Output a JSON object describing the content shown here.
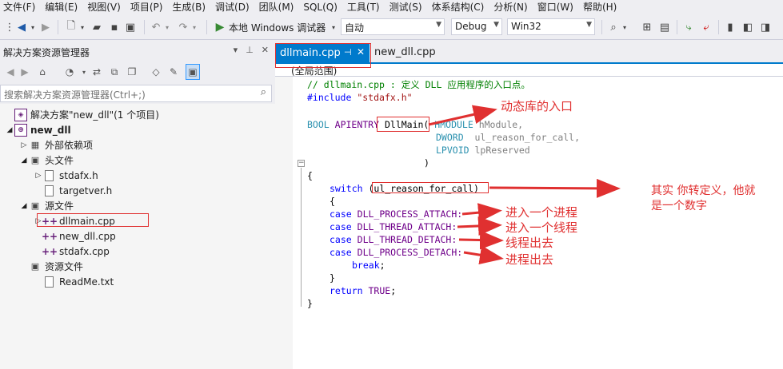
{
  "menu": [
    "文件(F)",
    "编辑(E)",
    "视图(V)",
    "项目(P)",
    "生成(B)",
    "调试(D)",
    "团队(M)",
    "SQL(Q)",
    "工具(T)",
    "测试(S)",
    "体系结构(C)",
    "分析(N)",
    "窗口(W)",
    "帮助(H)"
  ],
  "toolbar": {
    "run_label": "本地 Windows 调试器",
    "solution_config": "自动",
    "build_config": "Debug",
    "platform": "Win32"
  },
  "solution_explorer": {
    "title": "解决方案资源管理器",
    "search_placeholder": "搜索解决方案资源管理器(Ctrl+;)",
    "tree": [
      {
        "label": "解决方案\"new_dll\"(1 个项目)"
      },
      {
        "label": "new_dll"
      },
      {
        "label": "外部依赖项"
      },
      {
        "label": "头文件"
      },
      {
        "label": "stdafx.h"
      },
      {
        "label": "targetver.h"
      },
      {
        "label": "源文件"
      },
      {
        "label": "dllmain.cpp"
      },
      {
        "label": "new_dll.cpp"
      },
      {
        "label": "stdafx.cpp"
      },
      {
        "label": "资源文件"
      },
      {
        "label": "ReadMe.txt"
      }
    ]
  },
  "editor": {
    "tabs": [
      {
        "label": "dllmain.cpp",
        "active": true
      },
      {
        "label": "new_dll.cpp",
        "active": false
      }
    ],
    "scope": "(全局范围)",
    "code": {
      "l1": "// dllmain.cpp : 定义 DLL 应用程序的入口点。",
      "l2_kw": "#include",
      "l2_str": "\"stdafx.h\"",
      "l4_type": "BOOL",
      "l4_macro": "APIENTRY",
      "l4_func": "DllMain(",
      "l4_ptype": "HMODULE",
      "l4_param": "hModule,",
      "l5_ptype": "DWORD",
      "l5_param": "ul_reason_for_call,",
      "l6_ptype": "LPVOID",
      "l6_param": "lpReserved",
      "l7": ")",
      "l8": "{",
      "l9_kw": "switch",
      "l9_rest": "(ul_reason_for_call)",
      "l10": "{",
      "l11_kw": "case",
      "l11_macro": "DLL_PROCESS_ATTACH:",
      "l12_kw": "case",
      "l12_macro": "DLL_THREAD_ATTACH:",
      "l13_kw": "case",
      "l13_macro": "DLL_THREAD_DETACH:",
      "l14_kw": "case",
      "l14_macro": "DLL_PROCESS_DETACH:",
      "l15_kw": "break",
      "l15_rest": ";",
      "l16": "}",
      "l17_kw": "return",
      "l17_macro": "TRUE",
      "l17_rest": ";",
      "l18": "}"
    }
  },
  "annotations": {
    "entry": "动态库的入口",
    "reason_line1": "其实  你转定义，他就",
    "reason_line2": "是一个数字",
    "process_attach": "进入一个进程",
    "thread_attach": "进入一个线程",
    "thread_detach": "线程出去",
    "process_detach": "进程出去"
  },
  "colors": {
    "accent": "#007acc",
    "annotation": "#e03030"
  }
}
